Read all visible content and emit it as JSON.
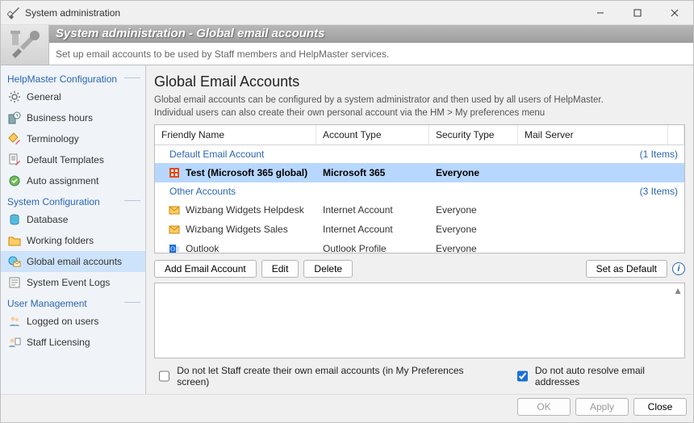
{
  "window": {
    "title": "System administration"
  },
  "banner": {
    "title": "System administration - Global email accounts",
    "subtitle": "Set up email accounts to be used by Staff members and HelpMaster services."
  },
  "sidebar": {
    "sections": [
      {
        "header": "HelpMaster Configuration",
        "items": [
          {
            "icon": "gear",
            "label": "General"
          },
          {
            "icon": "clock-building",
            "label": "Business hours"
          },
          {
            "icon": "tag-pencil",
            "label": "Terminology"
          },
          {
            "icon": "doc-pencil",
            "label": "Default Templates"
          },
          {
            "icon": "auto",
            "label": "Auto assignment"
          }
        ]
      },
      {
        "header": "System Configuration",
        "items": [
          {
            "icon": "database",
            "label": "Database"
          },
          {
            "icon": "folder",
            "label": "Working folders"
          },
          {
            "icon": "globe-mail",
            "label": "Global email accounts",
            "active": true
          },
          {
            "icon": "event-log",
            "label": "System Event Logs"
          }
        ]
      },
      {
        "header": "User Management",
        "items": [
          {
            "icon": "users",
            "label": "Logged on users"
          },
          {
            "icon": "license",
            "label": "Staff Licensing"
          }
        ]
      }
    ]
  },
  "page": {
    "title": "Global Email Accounts",
    "desc_line1": "Global email accounts can be configured by a system administrator and then used by all users of HelpMaster.",
    "desc_line2": "Individual users can also create their own personal account via the HM  > My preferences menu"
  },
  "grid": {
    "columns": [
      "Friendly Name",
      "Account Type",
      "Security Type",
      "Mail Server",
      ""
    ],
    "groups": [
      {
        "name": "Default Email Account",
        "count": "(1 Items)",
        "rows": [
          {
            "icon": "o365",
            "name": "Test (Microsoft 365 global)",
            "type": "Microsoft 365",
            "security": "Everyone",
            "server": "",
            "selected": true
          }
        ]
      },
      {
        "name": "Other Accounts",
        "count": "(3 Items)",
        "rows": [
          {
            "icon": "mail",
            "name": "Wizbang Widgets Helpdesk",
            "type": "Internet Account",
            "security": "Everyone",
            "server": ""
          },
          {
            "icon": "mail",
            "name": "Wizbang Widgets Sales",
            "type": "Internet Account",
            "security": "Everyone",
            "server": ""
          },
          {
            "icon": "outlook",
            "name": "Outlook",
            "type": "Outlook Profile",
            "security": "Everyone",
            "server": ""
          }
        ]
      }
    ]
  },
  "toolbar": {
    "add": "Add Email Account",
    "edit": "Edit",
    "delete": "Delete",
    "setdefault": "Set as Default"
  },
  "options": {
    "opt1_label": "Do not let Staff create their own email accounts (in My Preferences screen)",
    "opt1_checked": false,
    "opt2_label": "Do not auto resolve email addresses",
    "opt2_checked": true
  },
  "buttons": {
    "ok": "OK",
    "apply": "Apply",
    "close": "Close"
  }
}
